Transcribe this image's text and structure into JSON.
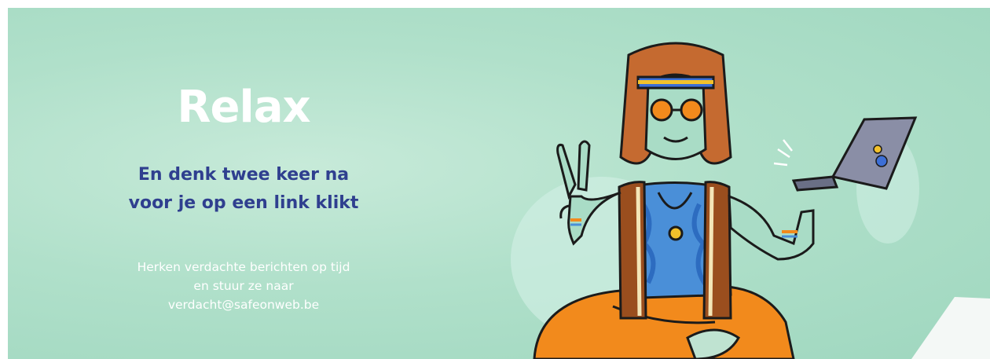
{
  "banner": {
    "headline": "Relax",
    "subheadline_line1": "En denk twee keer na",
    "subheadline_line2": "voor je op een link klikt",
    "body_line1": "Herken verdachte berichten op tijd",
    "body_line2": "en stuur ze naar",
    "body_line3": "verdacht@safeonweb.be"
  },
  "colors": {
    "background": "#b0e0ca",
    "headline": "#ffffff",
    "subheadline": "#2f3f8f",
    "body": "#ffffff",
    "accent_orange": "#f28a1c"
  }
}
